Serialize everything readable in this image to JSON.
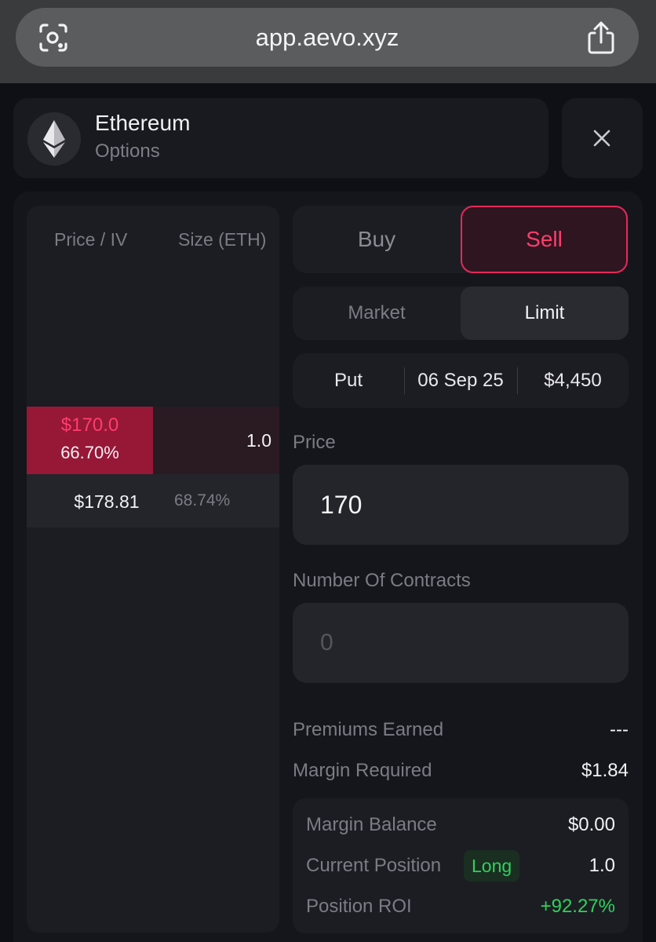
{
  "browser": {
    "url": "app.aevo.xyz"
  },
  "asset": {
    "name": "Ethereum",
    "type": "Options"
  },
  "orderbook": {
    "headers": {
      "price_iv": "Price / IV",
      "size": "Size (ETH)"
    },
    "ask": {
      "price": "$170.0",
      "iv": "66.70%",
      "size": "1.0"
    },
    "bid": {
      "price": "$178.81",
      "iv": "68.74%"
    }
  },
  "side": {
    "buy": "Buy",
    "sell": "Sell",
    "selected": "Sell"
  },
  "order_type": {
    "market": "Market",
    "limit": "Limit",
    "selected": "Limit"
  },
  "contract": {
    "kind": "Put",
    "expiry": "06 Sep 25",
    "strike": "$4,450"
  },
  "price": {
    "label": "Price",
    "value": "170"
  },
  "contracts": {
    "label": "Number Of Contracts",
    "placeholder": "0"
  },
  "summary": {
    "premiums_label": "Premiums Earned",
    "premiums_value": "---",
    "margin_req_label": "Margin Required",
    "margin_req_value": "$1.84"
  },
  "position": {
    "margin_balance_label": "Margin Balance",
    "margin_balance_value": "$0.00",
    "current_label": "Current Position",
    "current_badge": "Long",
    "current_value": "1.0",
    "roi_label": "Position ROI",
    "roi_value": "+92.27%"
  },
  "colors": {
    "accent_red": "#ff3d6c",
    "accent_green": "#2fd25a",
    "background": "#0f1015"
  },
  "icons": {
    "lens": "lens-icon",
    "share": "share-icon",
    "eth": "ethereum-logo-icon",
    "close": "close-icon"
  }
}
